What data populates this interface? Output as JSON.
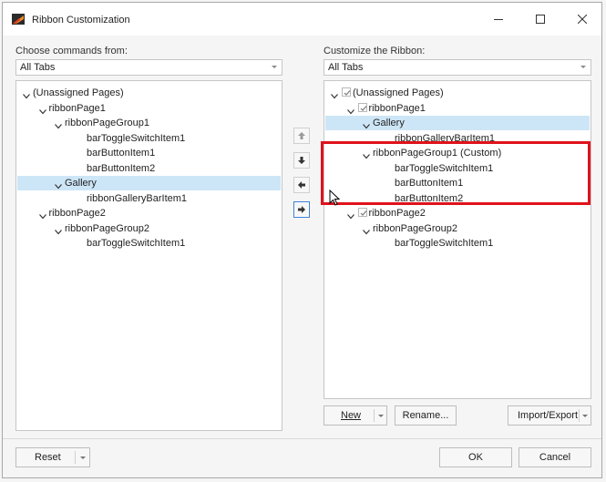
{
  "window": {
    "title": "Ribbon Customization"
  },
  "left": {
    "label": "Choose commands from:",
    "combo_value": "All Tabs",
    "tree": [
      {
        "text": "(Unassigned Pages)",
        "level": 0,
        "expander": "down"
      },
      {
        "text": "ribbonPage1",
        "level": 1,
        "expander": "down"
      },
      {
        "text": "ribbonPageGroup1",
        "level": 2,
        "expander": "down"
      },
      {
        "text": "barToggleSwitchItem1",
        "level": 4
      },
      {
        "text": "barButtonItem1",
        "level": 4
      },
      {
        "text": "barButtonItem2",
        "level": 4
      },
      {
        "text": "Gallery",
        "level": 2,
        "expander": "down",
        "selected": true
      },
      {
        "text": "ribbonGalleryBarItem1",
        "level": 4
      },
      {
        "text": "ribbonPage2",
        "level": 1,
        "expander": "down"
      },
      {
        "text": "ribbonPageGroup2",
        "level": 2,
        "expander": "down"
      },
      {
        "text": "barToggleSwitchItem1",
        "level": 4
      }
    ]
  },
  "right": {
    "label": "Customize the Ribbon:",
    "combo_value": "All Tabs",
    "tree": [
      {
        "text": "(Unassigned Pages)",
        "level": 0,
        "expander": "down",
        "checkbox": true
      },
      {
        "text": "ribbonPage1",
        "level": 1,
        "expander": "down",
        "checkbox": true
      },
      {
        "text": "Gallery",
        "level": 2,
        "expander": "down",
        "selected": true
      },
      {
        "text": "ribbonGalleryBarItem1",
        "level": 4
      },
      {
        "text": "ribbonPageGroup1 (Custom)",
        "level": 2,
        "expander": "down"
      },
      {
        "text": "barToggleSwitchItem1",
        "level": 4
      },
      {
        "text": "barButtonItem1",
        "level": 4
      },
      {
        "text": "barButtonItem2",
        "level": 4
      },
      {
        "text": "ribbonPage2",
        "level": 1,
        "expander": "down",
        "checkbox": true
      },
      {
        "text": "ribbonPageGroup2",
        "level": 2,
        "expander": "down"
      },
      {
        "text": "barToggleSwitchItem1",
        "level": 4
      }
    ]
  },
  "buttons": {
    "new": "New",
    "rename": "Rename...",
    "import_export": "Import/Export",
    "reset": "Reset",
    "ok": "OK",
    "cancel": "Cancel"
  },
  "icons": {
    "move_up": "arrow-up-icon",
    "move_down": "arrow-down-icon",
    "move_left": "arrow-left-icon",
    "move_right": "arrow-right-icon"
  },
  "colors": {
    "selection": "#cde6f7",
    "annotation_box": "#e0121b",
    "focus_border": "#3c7fd6"
  }
}
